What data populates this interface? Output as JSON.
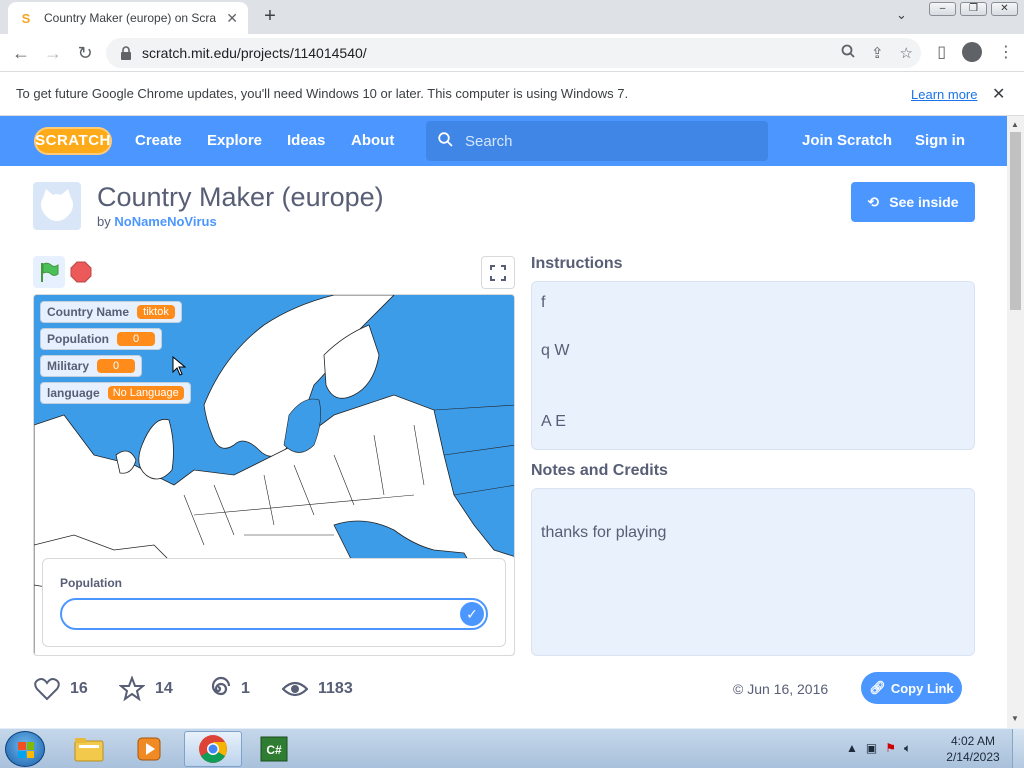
{
  "browser": {
    "tab_title": "Country Maker (europe) on Scratch",
    "new_tab": "+",
    "url": "scratch.mit.edu/projects/114014540/",
    "info_text": "To get future Google Chrome updates, you'll need Windows 10 or later. This computer is using Windows 7.",
    "learn_more": "Learn more"
  },
  "scratch": {
    "logo": "SCRATCH",
    "nav": [
      "Create",
      "Explore",
      "Ideas",
      "About"
    ],
    "search_placeholder": "Search",
    "join": "Join Scratch",
    "signin": "Sign in",
    "colors": {
      "brand_blue": "#4c97ff",
      "monitor_orange": "#ff8c1a"
    }
  },
  "project": {
    "title": "Country Maker (europe)",
    "by": "by",
    "author": "NoNameNoVirus",
    "see_inside": "See inside"
  },
  "stage": {
    "monitors": [
      {
        "label": "Country Name",
        "value": "tiktok"
      },
      {
        "label": "Population",
        "value": "0"
      },
      {
        "label": "Military",
        "value": "0"
      },
      {
        "label": "language",
        "value": "No Language"
      }
    ],
    "ask_label": "Population",
    "ask_value": ""
  },
  "instructions": {
    "title": "Instructions",
    "lines": [
      "f",
      "q W",
      "A E"
    ]
  },
  "notes": {
    "title": "Notes and Credits",
    "text": "thanks for playing"
  },
  "stats": {
    "loves": "16",
    "favorites": "14",
    "remixes": "1",
    "views": "1183"
  },
  "shared_date": "© Jun 16, 2016",
  "copy_link": "Copy Link",
  "taskbar": {
    "time": "4:02 AM",
    "date": "2/14/2023"
  }
}
